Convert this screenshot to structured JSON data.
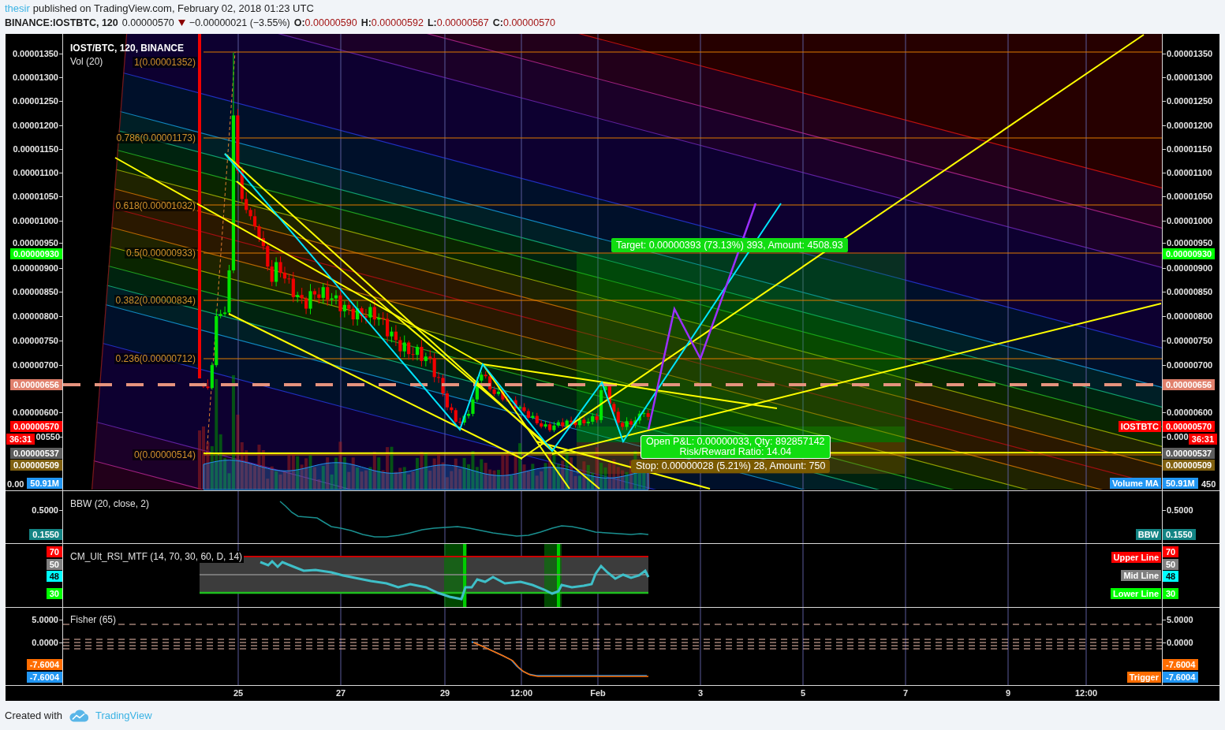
{
  "header": {
    "author": "thesir",
    "published": "published on TradingView.com, February 02, 2018 01:23 UTC"
  },
  "quote": {
    "symbol": "BINANCE:IOSTBTC, 120",
    "last": "0.00000570",
    "falling": true,
    "change": "−0.00000021 (−3.55%)",
    "ohlc": [
      {
        "label": "O:",
        "value": "0.00000590"
      },
      {
        "label": "H:",
        "value": "0.00000592"
      },
      {
        "label": "L:",
        "value": "0.00000567"
      },
      {
        "label": "C:",
        "value": "0.00000570"
      }
    ]
  },
  "main_pane": {
    "title": "IOST/BTC, 120, BINANCE",
    "indicator": "Vol (20)",
    "fib_levels": [
      "1(0.00001352)",
      "0.786(0.00001173)",
      "0.618(0.00001032)",
      "0.5(0.00000933)",
      "0.382(0.00000834)",
      "0.236(0.00000712)",
      "0(0.00000514)"
    ],
    "trade": {
      "target": "Target: 0.00000393 (73.13%) 393, Amount: 4508.93",
      "open_pnl": "Open P&L: 0.00000033, Qty: 892857142",
      "risk_reward": "Risk/Reward Ratio: 14.04",
      "stop": "Stop: 0.00000028 (5.21%) 28, Amount: 750"
    },
    "tags": [
      {
        "text": "IOSTBTC",
        "color": "#ff0000"
      },
      {
        "text": "Volume MA",
        "color": "#2196f3"
      }
    ],
    "left_axis": {
      "ticks": [
        "0.00001350",
        "0.00001300",
        "0.00001250",
        "0.00001200",
        "0.00001150",
        "0.00001100",
        "0.00001050",
        "0.00001000",
        "0.00000950",
        "0.00000900",
        "0.00000850",
        "0.00000800",
        "0.00000750",
        "0.00000700",
        "0.00000600",
        "00550",
        "0.00"
      ],
      "badges": [
        {
          "text": "0.00000930",
          "color": "#00ff00"
        },
        {
          "text": "0.00000656",
          "color": "#e0806c"
        },
        {
          "text": "0.00000570",
          "color": "#ff0000"
        },
        {
          "text": "36:31",
          "color": "#ff0000"
        },
        {
          "text": "0.00000537",
          "color": "#5d5d5d"
        },
        {
          "text": "0.00000509",
          "color": "#806010"
        },
        {
          "text": "50.91M",
          "color": "#2196f3"
        }
      ]
    },
    "right_axis": {
      "ticks": [
        "0.00001350",
        "0.00001300",
        "0.00001250",
        "0.00001200",
        "0.00001150",
        "0.00001100",
        "0.00001050",
        "0.00001000",
        "0.00000950",
        "0.00000900",
        "0.00000850",
        "0.00000800",
        "0.00000750",
        "0.00000700",
        "0.00000600",
        "0.000",
        "450"
      ],
      "badges": [
        {
          "text": "0.00000930",
          "color": "#00ff00"
        },
        {
          "text": "0.00000656",
          "color": "#e0806c"
        },
        {
          "text": "0.00000570",
          "color": "#ff0000"
        },
        {
          "text": "36:31",
          "color": "#ff0000"
        },
        {
          "text": "0.00000537",
          "color": "#5d5d5d"
        },
        {
          "text": "0.00000509",
          "color": "#806010"
        },
        {
          "text": "50.91M",
          "color": "#2196f3"
        }
      ]
    }
  },
  "bbw_pane": {
    "title": "BBW (20, close, 2)",
    "tags": [
      {
        "text": "BBW",
        "color": "#138484"
      }
    ],
    "left_axis": {
      "ticks": [
        "0.5000"
      ],
      "badges": [
        {
          "text": "0.1550",
          "color": "#138484"
        }
      ]
    },
    "right_axis": {
      "ticks": [
        "0.5000"
      ],
      "badges": [
        {
          "text": "0.1550",
          "color": "#138484"
        }
      ]
    }
  },
  "rsi_pane": {
    "title": "CM_Ult_RSI_MTF (14, 70, 30, 60, D, 14)",
    "tags": [
      {
        "text": "Upper Line",
        "color": "#ff0000"
      },
      {
        "text": "Mid Line",
        "color": "#808080"
      },
      {
        "text": "Lower Line",
        "color": "#00ff00"
      }
    ],
    "left_axis": {
      "badges": [
        {
          "text": "70",
          "color": "#ff0000"
        },
        {
          "text": "50",
          "color": "#808080"
        },
        {
          "text": "48",
          "color": "#00ffff"
        },
        {
          "text": "30",
          "color": "#00ff00"
        }
      ]
    },
    "right_axis": {
      "badges": [
        {
          "text": "70",
          "color": "#ff0000"
        },
        {
          "text": "50",
          "color": "#808080"
        },
        {
          "text": "48",
          "color": "#00ffff"
        },
        {
          "text": "30",
          "color": "#00ff00"
        }
      ]
    }
  },
  "fisher_pane": {
    "title": "Fisher (65)",
    "tags": [
      {
        "text": "Trigger",
        "color": "#ff6d00"
      }
    ],
    "left_axis": {
      "ticks": [
        "5.0000",
        "0.0000"
      ],
      "badges": [
        {
          "text": "-7.6004",
          "color": "#ff6d00"
        },
        {
          "text": "-7.6004",
          "color": "#2196f3"
        }
      ]
    },
    "right_axis": {
      "ticks": [
        "5.0000",
        "0.0000"
      ],
      "badges": [
        {
          "text": "-7.6004",
          "color": "#ff6d00"
        },
        {
          "text": "-7.6004",
          "color": "#2196f3"
        }
      ]
    }
  },
  "time_axis": [
    "25",
    "27",
    "29",
    "12:00",
    "Feb",
    "3",
    "5",
    "7",
    "9",
    "12:00"
  ],
  "footer": {
    "text": "Created with",
    "brand": "TradingView"
  }
}
